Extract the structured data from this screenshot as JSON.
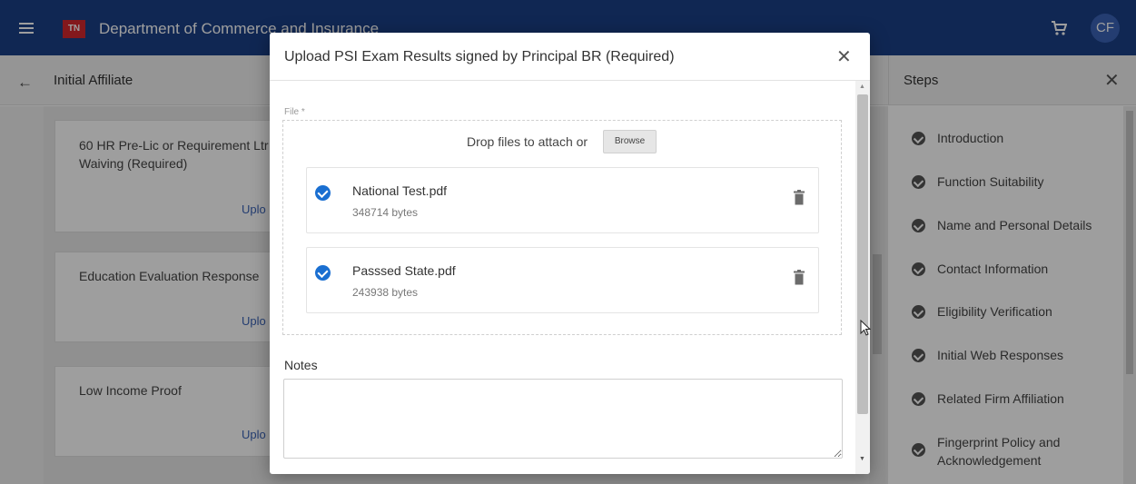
{
  "appbar": {
    "logo_text": "TN",
    "title": "Department of Commerce and Insurance",
    "avatar_initials": "CF"
  },
  "subbar": {
    "page_title": "Initial Affiliate",
    "steps_title": "Steps"
  },
  "cards": [
    {
      "label": "60 HR Pre-Lic or Requirement Ltr Waiving (Required)",
      "link": "Uplo"
    },
    {
      "label": "Education Evaluation Response",
      "link": "Uplo"
    },
    {
      "label": "Low Income Proof",
      "link": "Uplo"
    }
  ],
  "steps": [
    {
      "label": "Introduction"
    },
    {
      "label": "Function Suitability"
    },
    {
      "label": "Name and Personal Details"
    },
    {
      "label": "Contact Information"
    },
    {
      "label": "Eligibility Verification"
    },
    {
      "label": "Initial Web Responses"
    },
    {
      "label": "Related Firm Affiliation"
    },
    {
      "label": "Fingerprint Policy and Acknowledgement"
    }
  ],
  "modal": {
    "title": "Upload PSI Exam Results signed by Principal BR (Required)",
    "file_label": "File *",
    "drop_text": "Drop files to attach or",
    "browse_label": "Browse",
    "files": [
      {
        "name": "National Test.pdf",
        "size": "348714 bytes"
      },
      {
        "name": "Passsed State.pdf",
        "size": "243938 bytes"
      }
    ],
    "notes_label": "Notes"
  },
  "colors": {
    "appbar": "#1a3f86",
    "logo": "#d3272e",
    "check": "#1a6fd1"
  }
}
